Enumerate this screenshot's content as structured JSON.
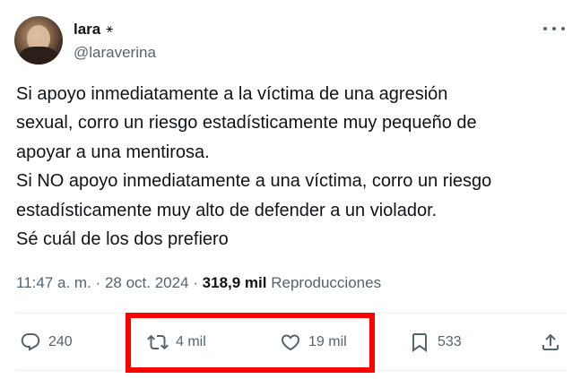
{
  "author": {
    "display_name": "lara",
    "name_glyph": "⚹",
    "handle": "@laraverina"
  },
  "tweet": {
    "lines": [
      "Si apoyo inmediatamente a la víctima de una agresión",
      "sexual, corro un riesgo estadísticamente muy pequeño de",
      "apoyar a una mentirosa.",
      "Si NO apoyo inmediatamente a una víctima, corro un riesgo",
      "estadísticamente muy alto de defender a un violador.",
      "Sé cuál de los dos prefiero"
    ]
  },
  "meta": {
    "time": "11:47 a. m.",
    "separator": "·",
    "date": "28 oct. 2024",
    "views_count": "318,9 mil",
    "views_label": "Reproducciones"
  },
  "actions": {
    "replies": "240",
    "retweets": "4 mil",
    "likes": "19 mil",
    "bookmarks": "533"
  },
  "icons": {
    "more": "more-dots-icon",
    "reply": "reply-bubble-icon",
    "retweet": "retweet-arrows-icon",
    "like": "heart-icon",
    "bookmark": "bookmark-icon",
    "share": "share-upload-icon"
  },
  "colors": {
    "text": "#0f1419",
    "secondary": "#536471",
    "divider": "#eff3f4",
    "highlight_box": "#ff0000"
  }
}
